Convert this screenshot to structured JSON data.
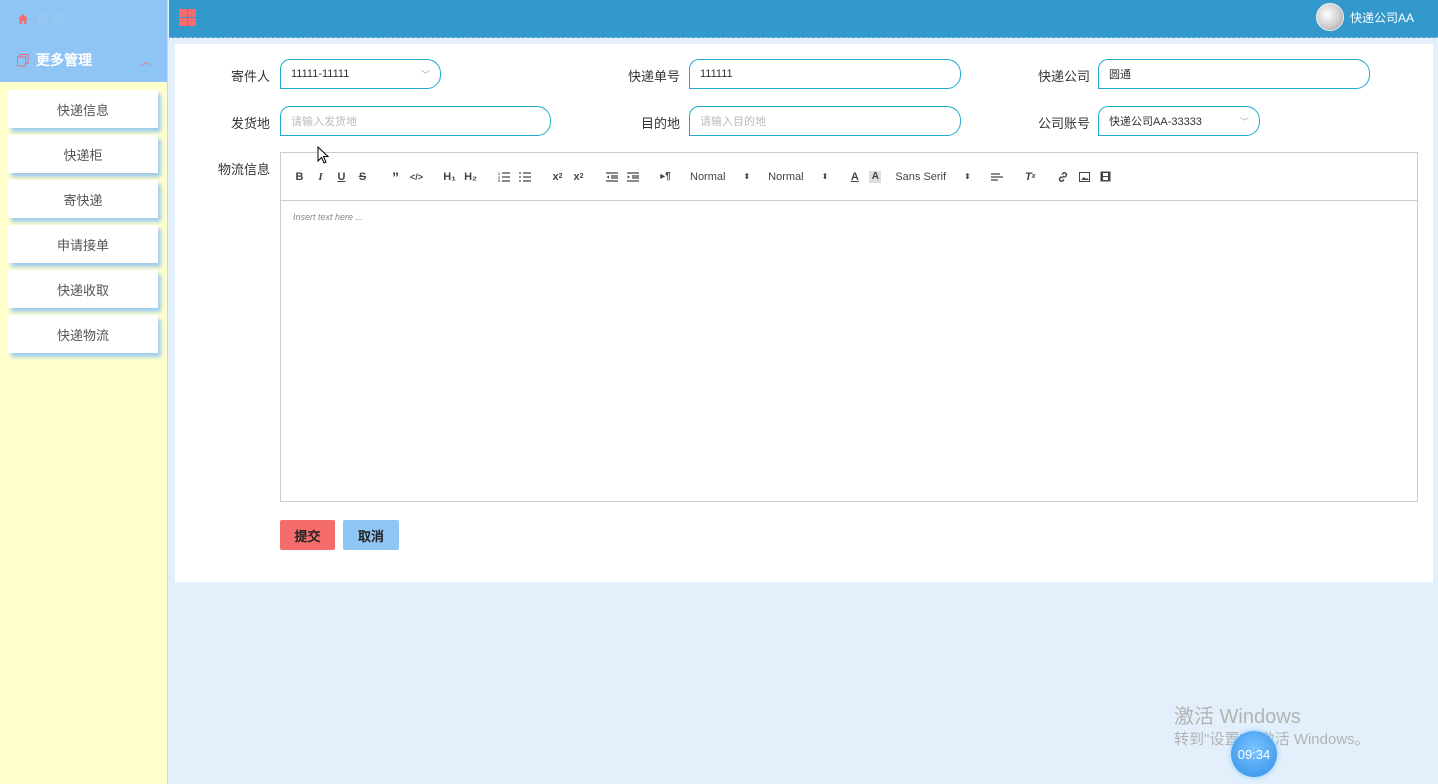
{
  "sidebar": {
    "home_label": "首页",
    "more_label": "更多管理",
    "items": [
      {
        "label": "快递信息"
      },
      {
        "label": "快递柜"
      },
      {
        "label": "寄快递"
      },
      {
        "label": "申请接单"
      },
      {
        "label": "快递收取"
      },
      {
        "label": "快递物流"
      }
    ]
  },
  "header": {
    "username": "快递公司AA"
  },
  "form": {
    "sender": {
      "label": "寄件人",
      "value": "11111-11111"
    },
    "tracking_no": {
      "label": "快递单号",
      "value": "111111"
    },
    "company": {
      "label": "快递公司",
      "value": "圆通"
    },
    "origin": {
      "label": "发货地",
      "placeholder": "请输入发货地"
    },
    "destination": {
      "label": "目的地",
      "placeholder": "请输入目的地"
    },
    "company_account": {
      "label": "公司账号",
      "value": "快递公司AA-33333"
    },
    "logistics": {
      "label": "物流信息",
      "placeholder": "Insert text here ..."
    }
  },
  "editor_toolbar": {
    "header_size": "Normal",
    "font_size": "Normal",
    "font_family": "Sans Serif",
    "h1": "H₁",
    "h2": "H₂"
  },
  "buttons": {
    "submit": "提交",
    "cancel": "取消"
  },
  "watermark": {
    "line1": "激活 Windows",
    "line2": "转到\"设置\"以激活 Windows。"
  },
  "clock": "09:34",
  "colors": {
    "accent": "#f56c6c",
    "topbar": "#3399cc",
    "sidebar_head": "#8ec5f5",
    "sidebar_bg": "#ffffcc",
    "field_border": "#22aacc"
  }
}
